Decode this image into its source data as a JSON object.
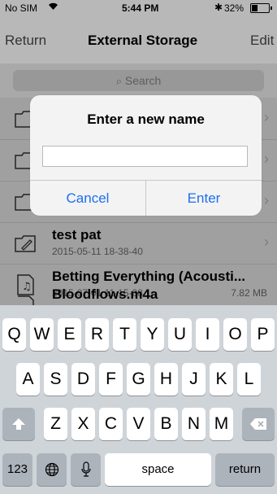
{
  "status": {
    "carrier": "No SIM",
    "time": "5:44 PM",
    "battery": "32%"
  },
  "nav": {
    "back": "Return",
    "title": "External Storage",
    "edit": "Edit"
  },
  "search": {
    "placeholder": "Search"
  },
  "files": [
    {
      "name": "",
      "date": "",
      "size": "",
      "icon": "folder-icon"
    },
    {
      "name": "",
      "date": "",
      "size": "",
      "icon": "folder-icon"
    },
    {
      "name": "",
      "date": "",
      "size": "",
      "icon": "folder-icon"
    },
    {
      "name": "test pat",
      "date": "2015-05-11 18-38-40",
      "size": "",
      "icon": "folder-edit-icon"
    },
    {
      "name": "Betting Everything (Acousti...",
      "date": "2015-07-01 11-15-08",
      "size": "7.82 MB",
      "icon": "music-file-icon"
    },
    {
      "name": "Bloodflows.m4a",
      "date": "",
      "size": "",
      "icon": "audio-file-icon"
    }
  ],
  "alert": {
    "title": "Enter a new name",
    "input_value": "",
    "cancel": "Cancel",
    "enter": "Enter"
  },
  "keyboard": {
    "row1": [
      "Q",
      "W",
      "E",
      "R",
      "T",
      "Y",
      "U",
      "I",
      "O",
      "P"
    ],
    "row2": [
      "A",
      "S",
      "D",
      "F",
      "G",
      "H",
      "J",
      "K",
      "L"
    ],
    "row3": [
      "Z",
      "X",
      "C",
      "V",
      "B",
      "N",
      "M"
    ],
    "numbers": "123",
    "space": "space",
    "return": "return"
  }
}
